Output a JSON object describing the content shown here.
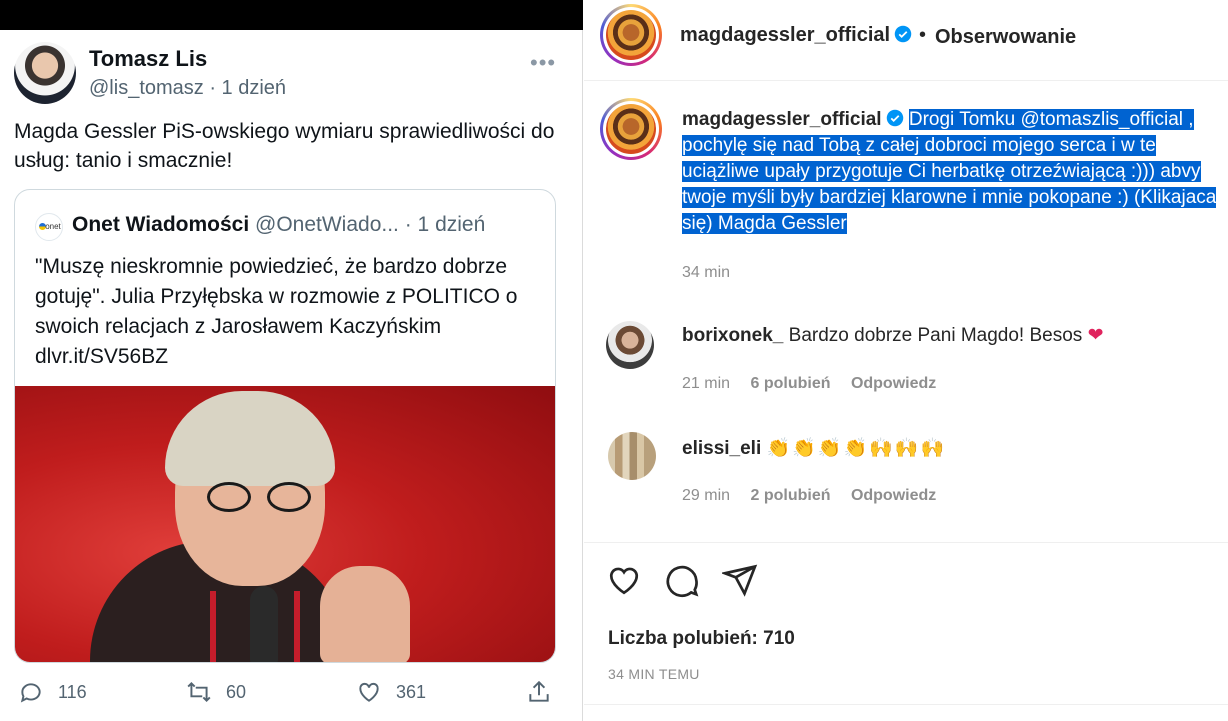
{
  "twitter": {
    "author": {
      "name": "Tomasz Lis",
      "handle_time": "@lis_tomasz · 1 dzień"
    },
    "more_icon": "more-horizontal-icon",
    "text": "Magda Gessler PiS-owskiego wymiaru sprawiedliwości do usług: tanio i smacznie!",
    "quote": {
      "logo_text": "onet",
      "name": "Onet Wiadomości",
      "handle_time": "@OnetWiado... · 1 dzień",
      "text": "\"Muszę nieskromnie powiedzieć, że bardzo dobrze gotuję\". Julia Przyłębska w rozmowie z POLITICO o swoich relacjach z Jarosławem Kaczyńskim dlvr.it/SV56BZ"
    },
    "actions": {
      "replies": "116",
      "retweets": "60",
      "likes": "361"
    }
  },
  "instagram": {
    "header": {
      "username": "magdagessler_official",
      "separator": "•",
      "follow_status": "Obserwowanie"
    },
    "caption": {
      "username": "magdagessler_official",
      "text": "Drogi Tomku @tomaszlis_official , pochylę się nad Tobą z całej dobroci mojego serca i w te uciążliwe upały przygotuje Ci herbatkę otrzeźwiającą :))) abvy twoje myśli były bardziej klarowne i mnie pokopane :) (Klikajaca się) Magda Gessler",
      "time": "34 min"
    },
    "comments": [
      {
        "username": "borixonek_",
        "text": "Bardzo dobrze Pani Magdo! Besos",
        "emoji": "❤",
        "time": "21 min",
        "likes": "6 polubień",
        "reply": "Odpowiedz"
      },
      {
        "username": "elissi_eli",
        "text": "",
        "emoji": "👏👏👏👏🙌🙌🙌",
        "time": "29 min",
        "likes": "2 polubień",
        "reply": "Odpowiedz"
      }
    ],
    "likes_label": "Liczba polubień: 710",
    "posted_ago": "34 MIN TEMU"
  },
  "colors": {
    "selection": "#0063d1",
    "verified": "#0095f6",
    "twitter_secondary": "#536471"
  }
}
